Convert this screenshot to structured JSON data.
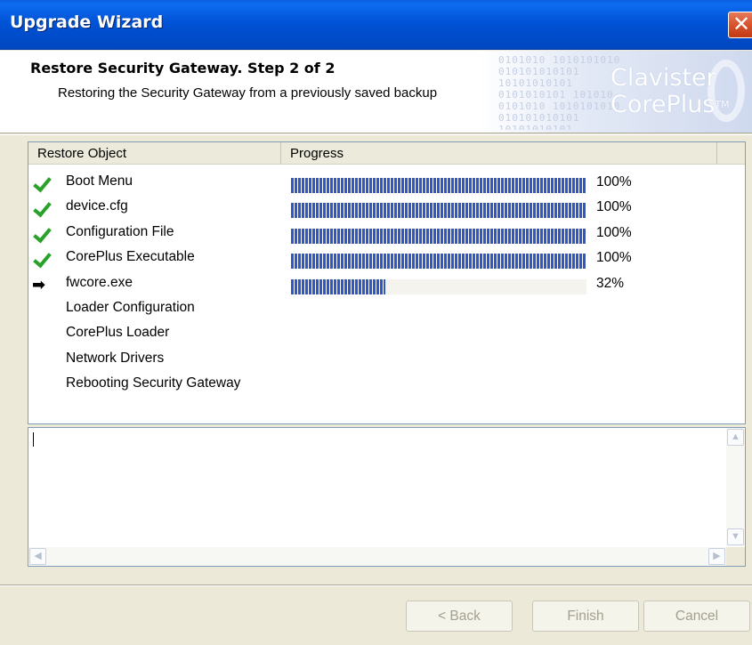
{
  "window": {
    "title": "Upgrade Wizard",
    "close_glyph": "✕"
  },
  "header": {
    "step_title": "Restore Security Gateway. Step 2 of 2",
    "step_description": "Restoring the Security Gateway from a previously saved backup",
    "brand_line1": "Clavister",
    "brand_line2": "CorePlus",
    "brand_tm": "TM",
    "binary_pattern": "0101010 1010101010 010101010101 10101010101 0101010101 101010 "
  },
  "list": {
    "columns": [
      "Restore Object",
      "Progress",
      ""
    ],
    "rows": [
      {
        "status": "done",
        "icon": "check-icon",
        "name": "Boot Menu",
        "progress": 100,
        "pct_text": "100%"
      },
      {
        "status": "done",
        "icon": "check-icon",
        "name": "device.cfg",
        "progress": 100,
        "pct_text": "100%"
      },
      {
        "status": "done",
        "icon": "check-icon",
        "name": "Configuration File",
        "progress": 100,
        "pct_text": "100%"
      },
      {
        "status": "done",
        "icon": "check-icon",
        "name": "CorePlus Executable",
        "progress": 100,
        "pct_text": "100%"
      },
      {
        "status": "active",
        "icon": "arrow-right-icon",
        "name": "fwcore.exe",
        "progress": 32,
        "pct_text": "32%"
      },
      {
        "status": "pending",
        "icon": "",
        "name": "Loader Configuration",
        "progress": null,
        "pct_text": ""
      },
      {
        "status": "pending",
        "icon": "",
        "name": "CorePlus Loader",
        "progress": null,
        "pct_text": ""
      },
      {
        "status": "pending",
        "icon": "",
        "name": "Network Drivers",
        "progress": null,
        "pct_text": ""
      },
      {
        "status": "pending",
        "icon": "",
        "name": "Rebooting Security Gateway",
        "progress": null,
        "pct_text": ""
      }
    ]
  },
  "log": {
    "text": ""
  },
  "buttons": {
    "back": "< Back",
    "finish": "Finish",
    "cancel": "Cancel"
  },
  "colors": {
    "titlebar": "#0053d6",
    "progress_fill": "#2f58c7",
    "check": "#2aa22a"
  }
}
